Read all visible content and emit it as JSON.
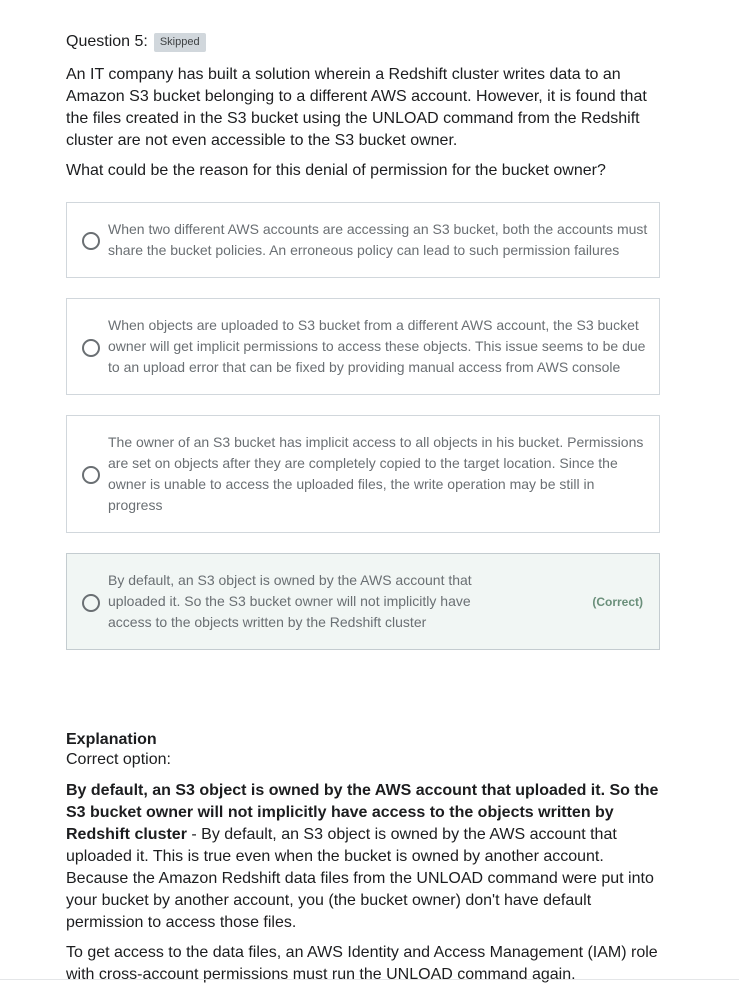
{
  "question": {
    "label": "Question 5:",
    "badge": "Skipped",
    "text": "An IT company has built a solution wherein a Redshift cluster writes data to an Amazon S3 bucket belonging to a different AWS account. However, it is found that the files created in the S3 bucket using the UNLOAD command from the Redshift cluster are not even accessible to the S3 bucket owner.",
    "prompt": "What could be the reason for this denial of permission for the bucket owner?"
  },
  "options": [
    {
      "text": "When two different AWS accounts are accessing an S3 bucket, both the accounts must share the bucket policies. An erroneous policy can lead to such permission failures"
    },
    {
      "text": "When objects are uploaded to S3 bucket from a different AWS account, the S3 bucket owner will get implicit permissions to access these objects. This issue seems to be due to an upload error that can be fixed by providing manual access from AWS console"
    },
    {
      "text": "The owner of an S3 bucket has implicit access to all objects in his bucket. Permissions are set on objects after they are completely copied to the target location. Since the owner is unable to access the uploaded files, the write operation may be still in progress"
    },
    {
      "text": "By default, an S3 object is owned by the AWS account that uploaded it. So the S3 bucket owner will not implicitly have access to the objects written by the Redshift cluster",
      "correct_label": "(Correct)"
    }
  ],
  "explanation": {
    "title": "Explanation",
    "subtitle": "Correct option:",
    "bold": "By default, an S3 object is owned by the AWS account that uploaded it. So the S3 bucket owner will not implicitly have access to the objects written by Redshift cluster",
    "body": " - By default, an S3 object is owned by the AWS account that uploaded it. This is true even when the bucket is owned by another account. Because the Amazon Redshift data files from the UNLOAD command were put into your bucket by another account, you (the bucket owner) don't have default permission to access those files.",
    "body2": "To get access to the data files, an AWS Identity and Access Management (IAM) role with cross-account permissions must run the UNLOAD command again."
  },
  "colors": {
    "correct_bg": "#f1f6f4",
    "correct_label": "#6a8f7a",
    "border": "#d1d7dc",
    "badge_bg": "#d1d7dc"
  }
}
